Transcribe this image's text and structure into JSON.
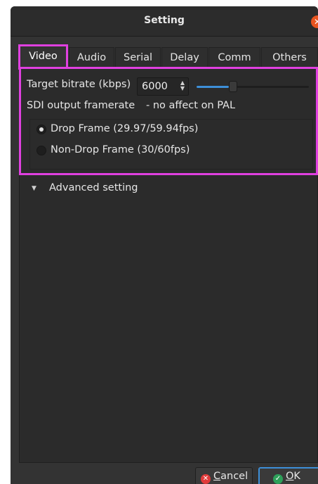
{
  "window": {
    "title": "Setting",
    "close_glyph": "✕"
  },
  "tabs": [
    {
      "label": "Video",
      "active": true
    },
    {
      "label": "Audio"
    },
    {
      "label": "Serial"
    },
    {
      "label": "Delay"
    },
    {
      "label": "Comm"
    },
    {
      "label": "Others"
    }
  ],
  "video": {
    "bitrate_label": "Target bitrate (kbps)",
    "bitrate_value": "6000",
    "bitrate_slider_fraction": 0.29,
    "framerate_label": "SDI output framerate",
    "framerate_note": "- no affect on PAL",
    "options": [
      {
        "label": "Drop Frame (29.97/59.94fps)",
        "checked": true
      },
      {
        "label": "Non-Drop Frame (30/60fps)",
        "checked": false
      }
    ],
    "advanced_label": "Advanced setting"
  },
  "buttons": {
    "cancel_mnemonic": "C",
    "cancel_rest": "ancel",
    "ok_mnemonic": "O",
    "ok_rest": "K"
  },
  "colors": {
    "accent": "#3d8fd8",
    "highlight": "#e040e0",
    "close": "#e95420"
  }
}
